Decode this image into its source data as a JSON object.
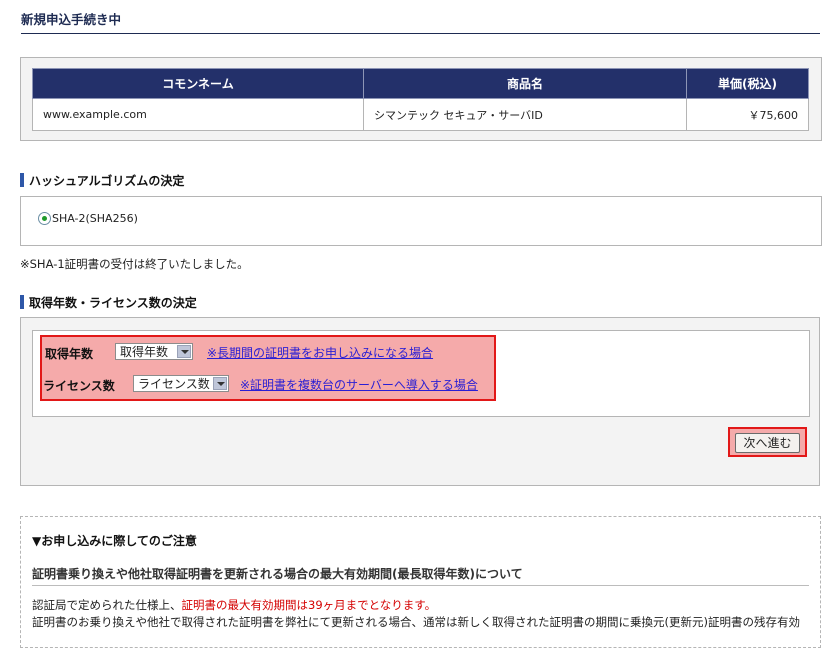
{
  "page": {
    "title": "新規申込手続き中"
  },
  "products": {
    "headers": [
      "コモンネーム",
      "商品名",
      "単価(税込)"
    ],
    "rows": [
      [
        "www.example.com",
        "シマンテック セキュア・サーバID",
        "￥75,600"
      ]
    ]
  },
  "hash": {
    "title": "ハッシュアルゴリズムの決定",
    "option_label": "SHA-2(SHA256)",
    "selected": true,
    "note": "※SHA-1証明書の受付は終了いたしました。"
  },
  "years": {
    "title": "取得年数・ライセンス数の決定",
    "years_label": "取得年数",
    "years_select": "取得年数",
    "years_link": "※長期間の証明書をお申し込みになる場合",
    "license_label": "ライセンス数",
    "license_select": "ライセンス数",
    "license_link": "※証明書を複数台のサーバーへ導入する場合",
    "next_button": "次へ進む"
  },
  "notice": {
    "title": "▼お申し込みに際してのご注意",
    "subtitle": "証明書乗り換えや他社取得証明書を更新される場合の最大有効期間(最長取得年数)について",
    "line1_prefix": "認証局で定められた仕様上、",
    "line1_red": "証明書の最大有効期間は39ヶ月までとなります。",
    "line2": "証明書のお乗り換えや他社で取得された証明書を弊社にて更新される場合、通常は新しく取得された証明書の期間に乗換元(更新元)証明書の残存有効"
  },
  "colors": {
    "header_bg": "#23306a",
    "highlight_border": "#e21818",
    "highlight_fill": "#f5aaaa",
    "link": "#2a1fd4"
  }
}
